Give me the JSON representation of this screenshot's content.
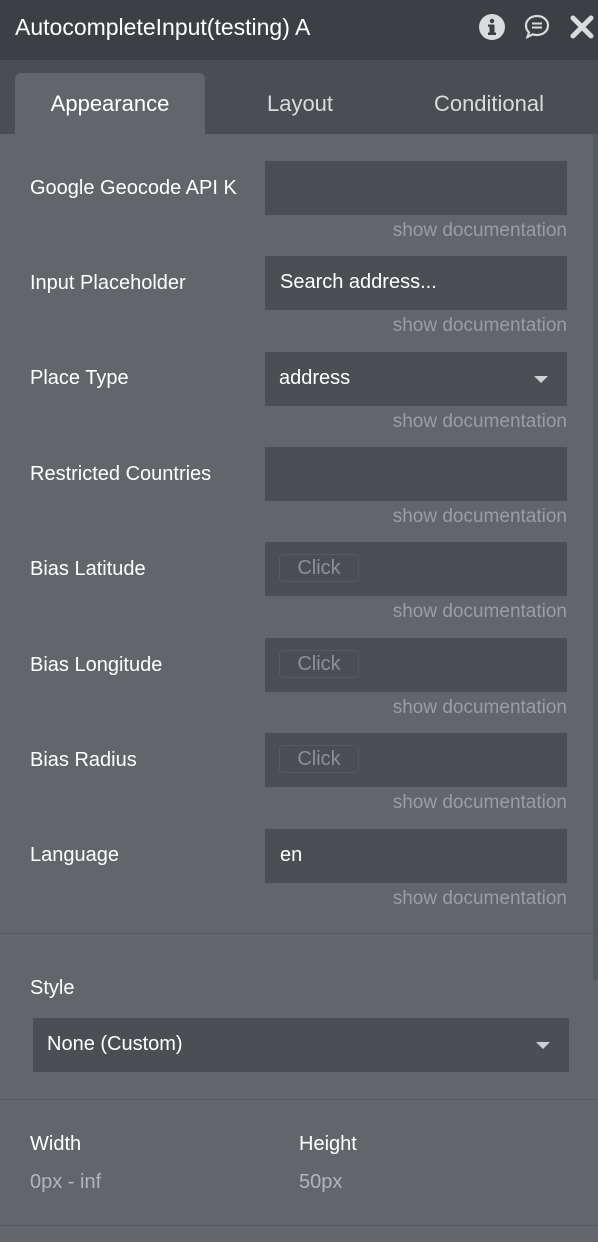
{
  "window": {
    "title": "AutocompleteInput(testing) A",
    "icons": [
      "info-icon",
      "comment-icon",
      "close-icon"
    ]
  },
  "tabs": [
    {
      "label": "Appearance",
      "active": true
    },
    {
      "label": "Layout",
      "active": false
    },
    {
      "label": "Conditional",
      "active": false
    }
  ],
  "properties": [
    {
      "label": "Google Geocode API K",
      "type": "text",
      "value": "",
      "doc": "show documentation"
    },
    {
      "label": "Input Placeholder",
      "type": "text",
      "value": "Search address...",
      "doc": "show documentation"
    },
    {
      "label": "Place Type",
      "type": "select",
      "value": "address",
      "doc": "show documentation"
    },
    {
      "label": "Restricted Countries",
      "type": "text",
      "value": "",
      "doc": "show documentation"
    },
    {
      "label": "Bias Latitude",
      "type": "dynamic",
      "value": "Click",
      "doc": "show documentation"
    },
    {
      "label": "Bias Longitude",
      "type": "dynamic",
      "value": "Click",
      "doc": "show documentation"
    },
    {
      "label": "Bias Radius",
      "type": "dynamic",
      "value": "Click",
      "doc": "show documentation"
    },
    {
      "label": "Language",
      "type": "text",
      "value": "en",
      "doc": "show documentation"
    }
  ],
  "style": {
    "label": "Style",
    "value": "None (Custom)"
  },
  "dimensions": {
    "width_label": "Width",
    "width_value": "0px - inf",
    "height_label": "Height",
    "height_value": "50px"
  },
  "colors": {
    "panel_bg": "#62666b",
    "header_bg": "#3c4045",
    "field_bg": "#4b4f54",
    "muted_text": "#9a9ea3"
  }
}
